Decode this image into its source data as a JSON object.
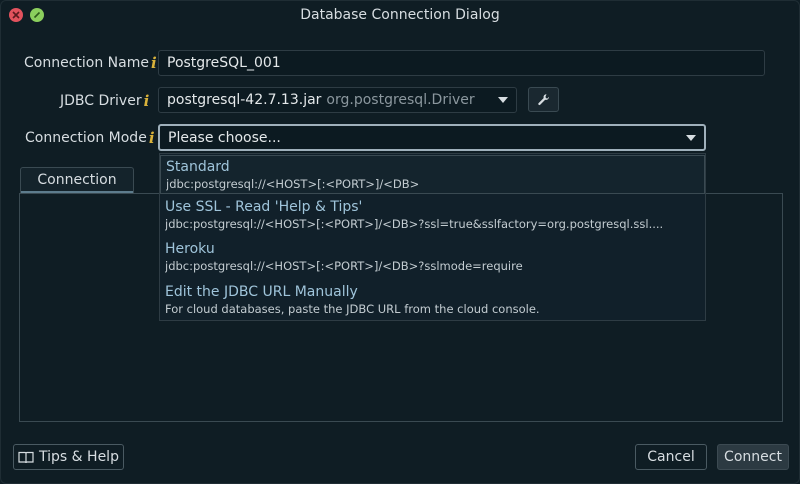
{
  "window": {
    "title": "Database Connection Dialog"
  },
  "form": {
    "connection_name": {
      "label": "Connection Name",
      "value": "PostgreSQL_001"
    },
    "jdbc_driver": {
      "label": "JDBC Driver",
      "value": "postgresql-42.7.13.jar",
      "value_secondary": "org.postgresql.Driver"
    },
    "connection_mode": {
      "label": "Connection Mode",
      "value": "Please choose..."
    }
  },
  "tabs": [
    {
      "label": "Connection"
    }
  ],
  "dropdown": {
    "options": [
      {
        "title": "Standard",
        "subtitle": "jdbc:postgresql://<HOST>[:<PORT>]/<DB>"
      },
      {
        "title": "Use SSL - Read 'Help & Tips'",
        "subtitle": "jdbc:postgresql://<HOST>[:<PORT>]/<DB>?ssl=true&sslfactory=org.postgresql.ssl...."
      },
      {
        "title": "Heroku",
        "subtitle": "jdbc:postgresql://<HOST>[:<PORT>]/<DB>?sslmode=require"
      },
      {
        "title": "Edit the JDBC URL Manually",
        "subtitle": "For cloud databases, paste the JDBC URL from the cloud console."
      }
    ]
  },
  "footer": {
    "tips_label": "Tips & Help",
    "cancel_label": "Cancel",
    "connect_label": "Connect"
  },
  "icons": {
    "info": "info-icon",
    "wrench": "wrench-icon",
    "book": "book-icon"
  },
  "colors": {
    "accent": "#9fc4da",
    "info": "#d9b23b",
    "close": "#e2525d",
    "maximize": "#8bcf5d"
  }
}
